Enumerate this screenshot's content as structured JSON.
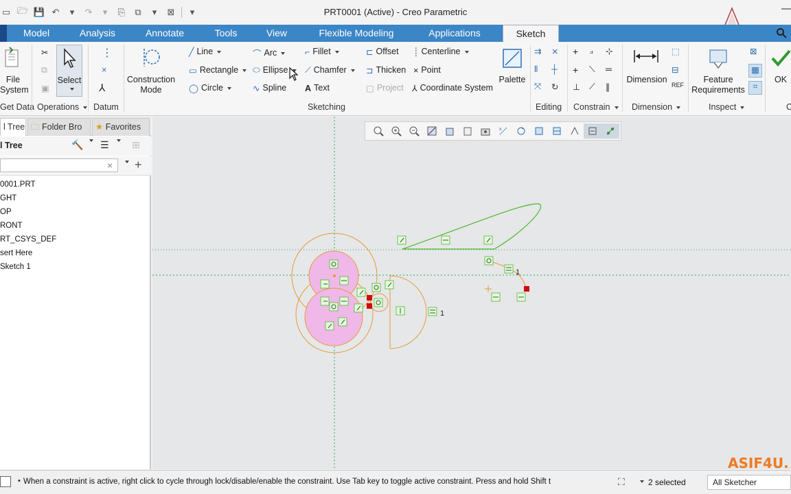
{
  "window": {
    "title": "PRT0001 (Active) - Creo Parametric"
  },
  "tabs": [
    "Model",
    "Analysis",
    "Annotate",
    "Tools",
    "View",
    "Flexible Modeling",
    "Applications",
    "Sketch"
  ],
  "ribbon": {
    "file_system": "File\nSystem",
    "select": "Select",
    "construction_mode": "Construction\nMode",
    "sketching_tools": {
      "line": "Line",
      "rectangle": "Rectangle",
      "circle": "Circle",
      "arc": "Arc",
      "ellipse": "Ellipse",
      "spline": "Spline",
      "fillet": "Fillet",
      "chamfer": "Chamfer",
      "text": "Text",
      "offset": "Offset",
      "thicken": "Thicken",
      "project": "Project",
      "centerline": "Centerline",
      "point": "Point",
      "coordinate_system": "Coordinate System"
    },
    "palette": "Palette",
    "dimension": "Dimension",
    "feature_requirements": "Feature\nRequirements",
    "ok": "OK",
    "groups": {
      "get_data": "Get Data",
      "operations": "Operations",
      "datum": "Datum",
      "sketching": "Sketching",
      "editing": "Editing",
      "constrain": "Constrain",
      "dimension": "Dimension",
      "inspect": "Inspect",
      "cut": "C"
    }
  },
  "left_panel": {
    "tabs": [
      "l Tree",
      "Folder Bro",
      "Favorites"
    ],
    "header": "l Tree",
    "tree_items": [
      "0001.PRT",
      "GHT",
      "OP",
      "RONT",
      "RT_CSYS_DEF",
      "sert Here",
      "Sketch 1"
    ]
  },
  "canvas": {
    "dims": [
      "1",
      "1"
    ],
    "watermark": "ASIF4U."
  },
  "status": {
    "message": "When a constraint is active, right click to cycle through lock/disable/enable the constraint. Use Tab key to toggle active constraint. Press and hold Shift t",
    "selected": "2 selected",
    "filter": "All Sketcher"
  },
  "colors": {
    "accent": "#3b86c6",
    "sketch_entity": "#e59a3a",
    "selected_entity": "#4bb82a",
    "shaded_region": "#efb8e9",
    "datum_line": "#22a866",
    "constraint_highlight": "#d10b0b",
    "watermark": "#f07a22"
  }
}
